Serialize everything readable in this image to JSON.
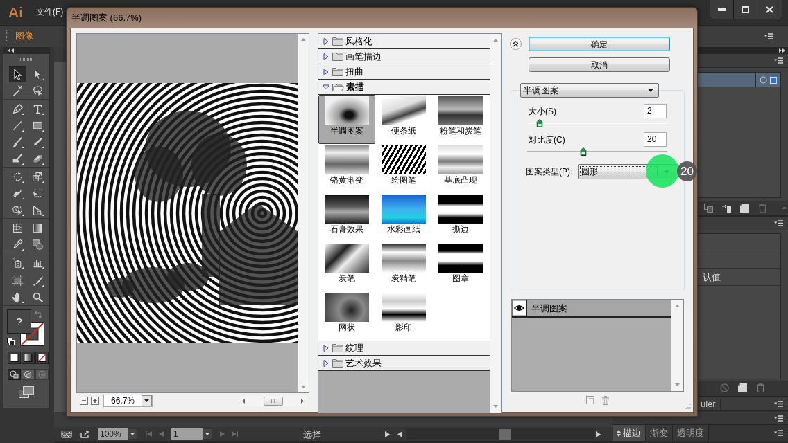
{
  "app": {
    "logo": "Ai",
    "menu": [
      "文件(F)"
    ],
    "control_bar": {
      "label": "图像"
    }
  },
  "tools": [
    {
      "selected": true
    },
    {
      "selected": false
    },
    {
      "selected": false
    },
    {
      "selected": false
    },
    {
      "selected": false
    },
    {
      "selected": false
    },
    {
      "selected": false
    },
    {
      "selected": false
    },
    {
      "selected": false
    },
    {
      "selected": false
    },
    {
      "selected": false
    },
    {
      "selected": false
    },
    {
      "selected": false
    },
    {
      "selected": false
    },
    {
      "selected": false
    },
    {
      "selected": false
    },
    {
      "selected": false
    },
    {
      "selected": false
    },
    {
      "selected": false
    },
    {
      "selected": false
    },
    {
      "selected": false
    },
    {
      "selected": false
    },
    {
      "selected": false
    },
    {
      "selected": false
    },
    {
      "selected": false
    },
    {
      "selected": false
    },
    {
      "selected": false
    },
    {
      "selected": false
    }
  ],
  "color_controls": {
    "fill_label": "?"
  },
  "right_panels": {
    "top_panel": {
      "rows": [
        {
          "selected": true
        }
      ]
    },
    "middle_panel": {
      "row_text": "认值"
    },
    "collapsed_tab": "uler",
    "bottom_tabs": [
      {
        "label": "描边",
        "selected": true
      },
      {
        "label": "渐变",
        "selected": false
      },
      {
        "label": "透明度",
        "selected": false
      }
    ]
  },
  "dialog": {
    "title": "半调图案 (66.7%)",
    "preview": {
      "zoom": "66.7%"
    },
    "gallery": [
      {
        "name": "风格化",
        "expanded": false
      },
      {
        "name": "画笔描边",
        "expanded": false
      },
      {
        "name": "扭曲",
        "expanded": false
      },
      {
        "name": "素描",
        "expanded": true,
        "filters": [
          {
            "name": "半调图案",
            "selected": true
          },
          {
            "name": "便条纸",
            "selected": false
          },
          {
            "name": "粉笔和炭笔",
            "selected": false
          },
          {
            "name": "铬黄渐变",
            "selected": false
          },
          {
            "name": "绘图笔",
            "selected": false
          },
          {
            "name": "基底凸现",
            "selected": false
          },
          {
            "name": "石膏效果",
            "selected": false
          },
          {
            "name": "水彩画纸",
            "selected": false
          },
          {
            "name": "撕边",
            "selected": false
          },
          {
            "name": "炭笔",
            "selected": false
          },
          {
            "name": "炭精笔",
            "selected": false
          },
          {
            "name": "图章",
            "selected": false
          },
          {
            "name": "网状",
            "selected": false
          },
          {
            "name": "影印",
            "selected": false
          }
        ]
      },
      {
        "name": "纹理",
        "expanded": false
      },
      {
        "name": "艺术效果",
        "expanded": false
      }
    ],
    "buttons": [
      {
        "label": "确定",
        "default": true
      },
      {
        "label": "取消",
        "default": false
      }
    ],
    "filter_select": {
      "value": "半调图案"
    },
    "settings": [
      {
        "kind": "slider",
        "label": "大小(S)",
        "value": "2",
        "level": 0.09
      },
      {
        "kind": "slider",
        "label": "对比度(C)",
        "value": "20",
        "level": 0.4
      },
      {
        "kind": "select",
        "label": "图案类型(P):",
        "value": "圆形"
      }
    ],
    "layers": [
      {
        "name": "半调图案",
        "visible": true
      }
    ]
  },
  "status_bar": {
    "zoom": "100%",
    "artboard": "1",
    "tool": "选择"
  },
  "tutorial": {
    "step": "20"
  }
}
